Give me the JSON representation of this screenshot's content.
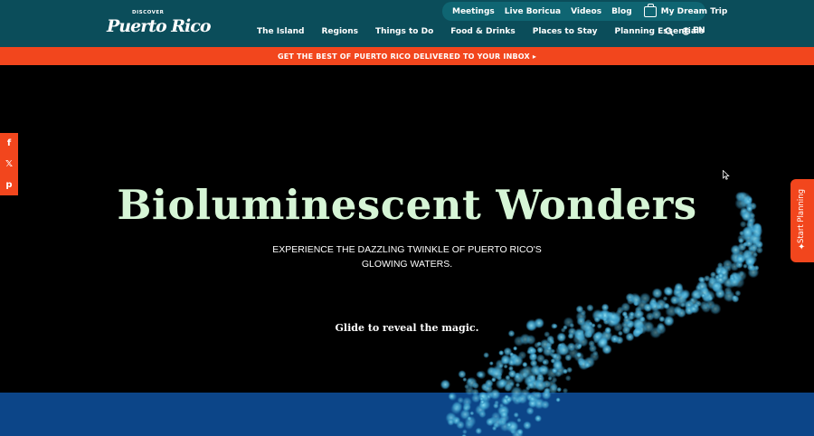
{
  "brand": {
    "discover": "DISCOVER",
    "name": "Puerto Rico"
  },
  "utility_nav": {
    "links": [
      "Meetings",
      "Live Boricua",
      "Videos",
      "Blog"
    ],
    "dream_trip": "My Dream Trip"
  },
  "main_nav": {
    "links": [
      "The Island",
      "Regions",
      "Things to Do",
      "Food & Drinks",
      "Places to Stay",
      "Planning Essentials"
    ],
    "language": "EN"
  },
  "banner": {
    "text": "GET THE BEST OF PUERTO RICO DELIVERED TO YOUR INBOX ▸"
  },
  "hero": {
    "title": "Bioluminescent Wonders",
    "subtitle": "EXPERIENCE THE DAZZLING TWINKLE OF PUERTO RICO'S GLOWING WATERS.",
    "cta": "Glide to reveal the magic."
  },
  "social": {
    "icons": [
      "facebook-icon",
      "x-icon",
      "pinterest-icon"
    ],
    "glyphs": [
      "f",
      "𝕏",
      "p"
    ]
  },
  "side_tab": {
    "label": "Start Planning",
    "icon": "✦"
  },
  "colors": {
    "header": "#0b4d5a",
    "utility_pill": "#0f6572",
    "accent": "#f2461d",
    "title": "#d6f5d6",
    "bottom_band": "#0c4588",
    "glow": "#4fb4d8"
  }
}
